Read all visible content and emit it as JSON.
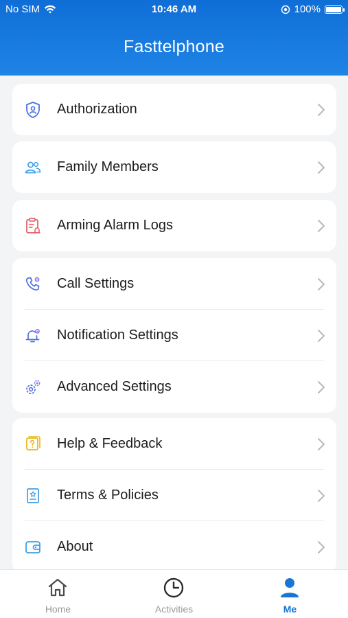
{
  "status_bar": {
    "carrier": "No SIM",
    "time": "10:46 AM",
    "battery": "100%"
  },
  "header": {
    "title": "Fasttelphone"
  },
  "menu": {
    "authorization": "Authorization",
    "family_members": "Family Members",
    "arming_alarm_logs": "Arming Alarm Logs",
    "call_settings": "Call Settings",
    "notification_settings": "Notification Settings",
    "advanced_settings": "Advanced Settings",
    "help_feedback": "Help & Feedback",
    "terms_policies": "Terms & Policies",
    "about": "About"
  },
  "tabs": {
    "home": "Home",
    "activities": "Activities",
    "me": "Me",
    "active": "Me"
  },
  "colors": {
    "header": "#1a7ee0",
    "accent": "#1976d2",
    "background": "#f3f4f6"
  }
}
